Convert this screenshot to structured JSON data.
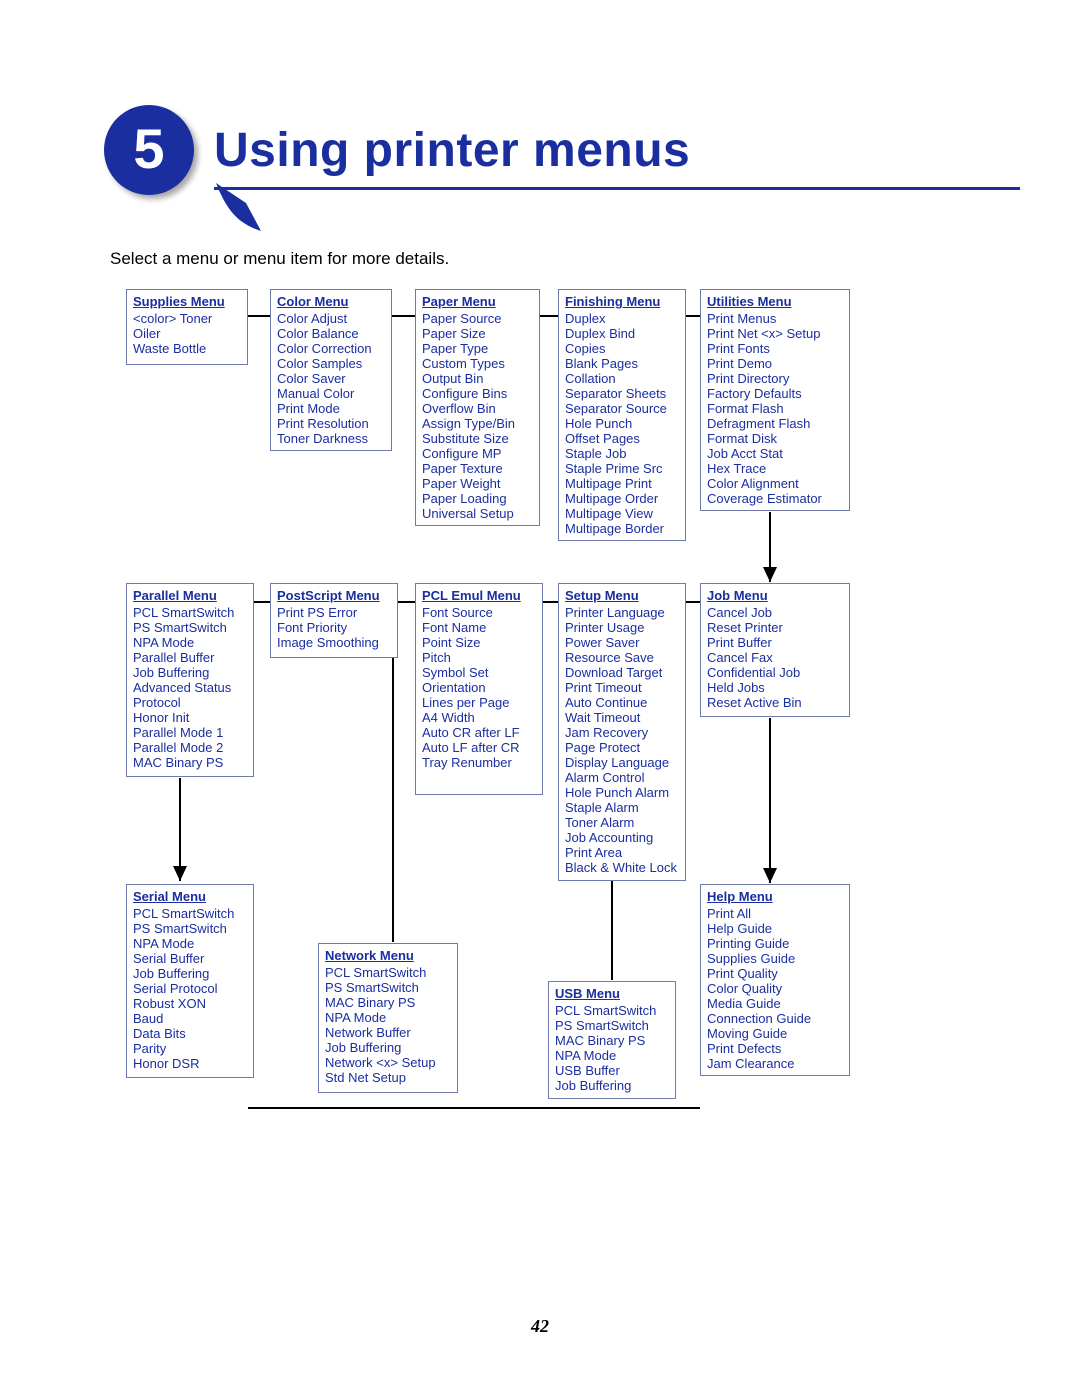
{
  "chapter_number": "5",
  "page_title": "Using printer menus",
  "intro": "Select a menu or menu item for more details.",
  "page_number": "42",
  "menus": {
    "supplies": {
      "title": "Supplies Menu",
      "items": [
        "<color> Toner",
        "Oiler",
        "Waste Bottle"
      ]
    },
    "color": {
      "title": "Color Menu",
      "items": [
        "Color Adjust",
        "Color Balance",
        "Color Correction",
        "Color Samples",
        "Color Saver",
        "Manual Color",
        "Print Mode",
        "Print Resolution",
        "Toner Darkness"
      ]
    },
    "paper": {
      "title": "Paper Menu",
      "items": [
        "Paper Source",
        "Paper Size",
        "Paper Type",
        "Custom Types",
        "Output Bin",
        "Configure Bins",
        "Overflow Bin",
        "Assign Type/Bin",
        "Substitute Size",
        "Configure MP",
        "Paper Texture",
        "Paper Weight",
        "Paper Loading",
        "Universal Setup"
      ]
    },
    "finishing": {
      "title": "Finishing Menu",
      "items": [
        "Duplex",
        "Duplex Bind",
        "Copies",
        "Blank Pages",
        "Collation",
        "Separator Sheets",
        "Separator Source",
        "Hole Punch",
        "Offset Pages",
        "Staple Job",
        "Staple Prime Src",
        "Multipage Print",
        "Multipage Order",
        "Multipage View",
        "Multipage Border"
      ]
    },
    "utilities": {
      "title": "Utilities Menu",
      "items": [
        "Print Menus",
        "Print Net <x> Setup",
        "Print Fonts",
        "Print Demo",
        "Print Directory",
        "Factory Defaults",
        "Format Flash",
        "Defragment Flash",
        "Format Disk",
        "Job Acct Stat",
        "Hex Trace",
        "Color Alignment",
        "Coverage Estimator"
      ]
    },
    "parallel": {
      "title": "Parallel Menu",
      "items": [
        "PCL SmartSwitch",
        "PS SmartSwitch",
        "NPA Mode",
        "Parallel Buffer",
        "Job Buffering",
        "Advanced Status",
        "Protocol",
        "Honor Init",
        "Parallel Mode 1",
        "Parallel Mode 2",
        "MAC Binary PS"
      ]
    },
    "postscript": {
      "title": "PostScript Menu",
      "items": [
        "Print PS Error",
        "Font Priority",
        "Image Smoothing"
      ]
    },
    "pclemul": {
      "title": "PCL Emul Menu",
      "items": [
        "Font Source",
        "Font Name",
        "Point Size",
        "Pitch",
        "Symbol Set",
        "Orientation",
        "Lines per Page",
        "A4 Width",
        "Auto CR after LF",
        "Auto LF after CR",
        "Tray Renumber"
      ]
    },
    "setup": {
      "title": "Setup Menu",
      "items": [
        "Printer Language",
        "Printer Usage",
        "Power Saver",
        "Resource Save",
        "Download Target",
        "Print Timeout",
        "Auto Continue",
        "Wait Timeout",
        "Jam Recovery",
        "Page Protect",
        "Display Language",
        "Alarm Control",
        "Hole Punch Alarm",
        "Staple Alarm",
        "Toner Alarm",
        "Job Accounting",
        "Print Area",
        "Black & White Lock"
      ]
    },
    "job": {
      "title": "Job Menu",
      "items": [
        "Cancel Job",
        "Reset Printer",
        "Print Buffer",
        "Cancel Fax",
        "Confidential Job",
        "Held Jobs",
        "Reset Active Bin"
      ]
    },
    "serial": {
      "title": "Serial Menu",
      "items": [
        "PCL SmartSwitch",
        "PS SmartSwitch",
        "NPA Mode",
        "Serial Buffer",
        "Job Buffering",
        "Serial Protocol",
        "Robust XON",
        "Baud",
        "Data Bits",
        "Parity",
        "Honor DSR"
      ]
    },
    "network": {
      "title": "Network Menu",
      "items": [
        "PCL SmartSwitch",
        "PS SmartSwitch",
        "MAC Binary PS",
        "NPA Mode",
        "Network Buffer",
        "Job Buffering",
        "Network <x> Setup",
        "Std Net Setup"
      ]
    },
    "usb": {
      "title": "USB Menu",
      "items": [
        "PCL SmartSwitch",
        "PS SmartSwitch",
        "MAC Binary PS",
        "NPA Mode",
        "USB Buffer",
        "Job Buffering"
      ]
    },
    "help": {
      "title": "Help Menu",
      "items": [
        "Print All",
        "Help Guide",
        "Printing Guide",
        "Supplies Guide",
        "Print Quality",
        "Color Quality",
        "Media Guide",
        "Connection Guide",
        "Moving Guide",
        "Print Defects",
        "Jam Clearance"
      ]
    }
  }
}
